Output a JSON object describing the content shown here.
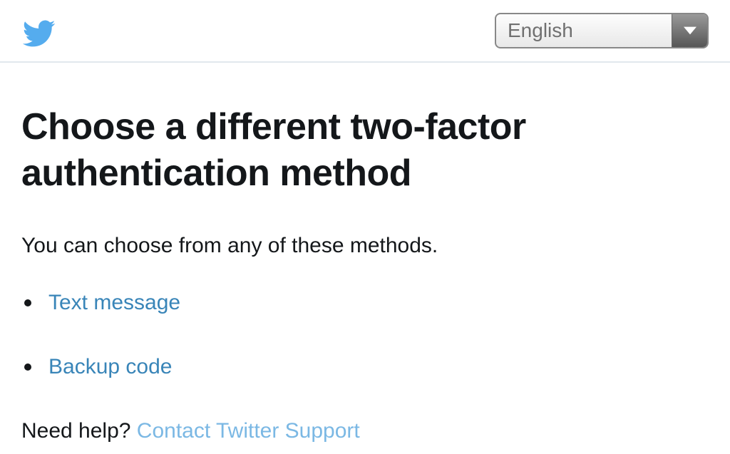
{
  "header": {
    "language": "English"
  },
  "main": {
    "title": "Choose a different two-factor authentication method",
    "subtitle": "You can choose from any of these methods.",
    "methods": [
      {
        "label": "Text message"
      },
      {
        "label": "Backup code"
      }
    ],
    "help_prefix": "Need help? ",
    "help_link": "Contact Twitter Support"
  }
}
